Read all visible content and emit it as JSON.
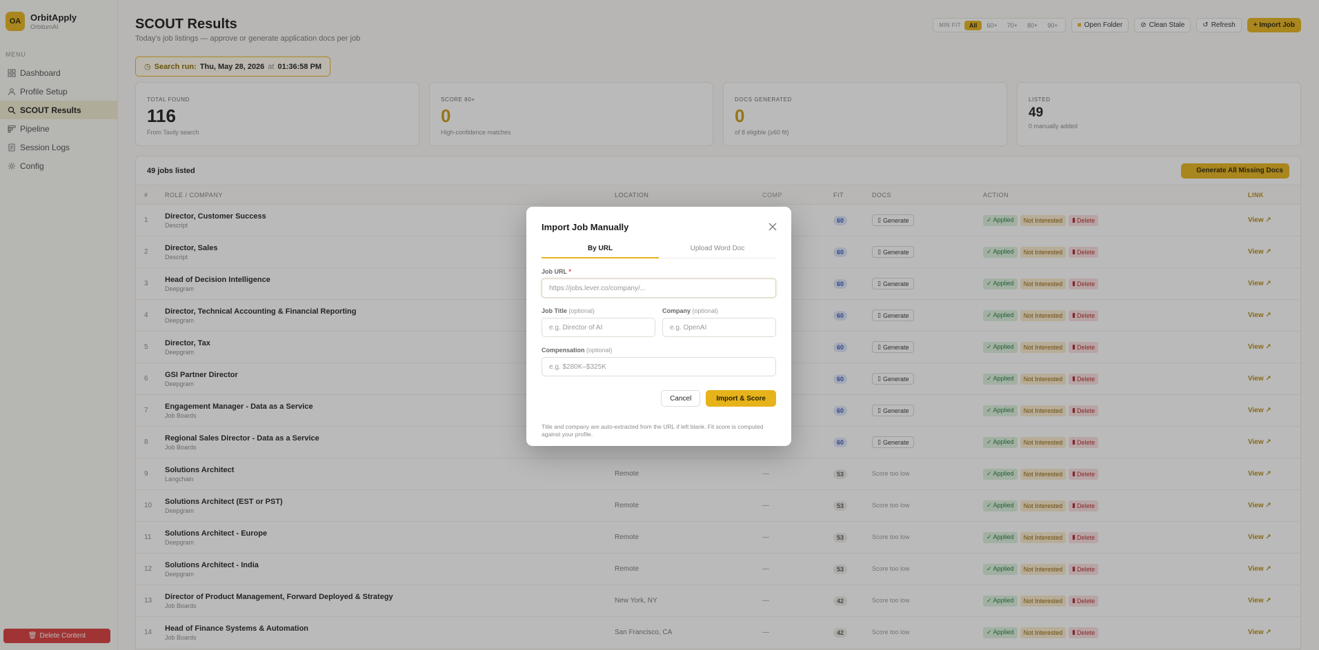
{
  "brand": {
    "initials": "OA",
    "name": "OrbitApply",
    "sub": "OrbitumAI"
  },
  "sidebar": {
    "menu_label": "MENU",
    "items": [
      {
        "label": "Dashboard",
        "icon": "grid-icon"
      },
      {
        "label": "Profile Setup",
        "icon": "user-icon"
      },
      {
        "label": "SCOUT Results",
        "icon": "search-icon",
        "active": true
      },
      {
        "label": "Pipeline",
        "icon": "pipeline-icon"
      },
      {
        "label": "Session Logs",
        "icon": "document-icon"
      },
      {
        "label": "Config",
        "icon": "gear-icon"
      }
    ],
    "delete_label": "Delete Content"
  },
  "page": {
    "title": "SCOUT Results",
    "subtitle": "Today's job listings — approve or generate application docs per job"
  },
  "toolbar": {
    "min_fit_label": "MIN FIT",
    "fit_options": [
      "All",
      "60+",
      "70+",
      "80+",
      "90+"
    ],
    "open_folder": "Open Folder",
    "clean_stale": "Clean Stale",
    "refresh": "Refresh",
    "import_job": "+ Import Job"
  },
  "search_run": {
    "label": "Search run:",
    "date": "Thu, May 28, 2026",
    "at": "at",
    "time": "01:36:58 PM"
  },
  "stats": [
    {
      "label": "TOTAL FOUND",
      "value": "116",
      "note": "From Tavily search"
    },
    {
      "label": "SCORE 80+",
      "value": "0",
      "note": "High-confidence matches"
    },
    {
      "label": "DOCS GENERATED",
      "value": "0",
      "note": "of 8 eligible (≥60 fit)"
    },
    {
      "label": "LISTED",
      "value": "49",
      "note": "0 manually added"
    }
  ],
  "table": {
    "count_label": "49 jobs listed",
    "generate_all": "Generate All Missing Docs",
    "headers": {
      "num": "#",
      "role": "ROLE / COMPANY",
      "location": "LOCATION",
      "comp": "COMP",
      "fit": "FIT",
      "docs": "DOCS",
      "action": "ACTION",
      "link": "LINK"
    },
    "generate_label": "Generate",
    "score_low_label": "Score too low",
    "applied_label": "✓ Applied",
    "not_interested_label": "Not Interested",
    "delete_label": "Delete",
    "view_label": "View ↗",
    "rows": [
      {
        "num": "1",
        "title": "Director, Customer Success",
        "company": "Descript",
        "location": "",
        "comp": "",
        "fit": "60",
        "docs": "generate"
      },
      {
        "num": "2",
        "title": "Director, Sales",
        "company": "Descript",
        "location": "",
        "comp": "",
        "fit": "60",
        "docs": "generate"
      },
      {
        "num": "3",
        "title": "Head of Decision Intelligence",
        "company": "Deepgram",
        "location": "",
        "comp": "",
        "fit": "60",
        "docs": "generate"
      },
      {
        "num": "4",
        "title": "Director, Technical Accounting & Financial Reporting",
        "company": "Deepgram",
        "location": "",
        "comp": "",
        "fit": "60",
        "docs": "generate"
      },
      {
        "num": "5",
        "title": "Director, Tax",
        "company": "Deepgram",
        "location": "",
        "comp": "",
        "fit": "60",
        "docs": "generate"
      },
      {
        "num": "6",
        "title": "GSI Partner Director",
        "company": "Deepgram",
        "location": "",
        "comp": "",
        "fit": "60",
        "docs": "generate"
      },
      {
        "num": "7",
        "title": "Engagement Manager - Data as a Service",
        "company": "Job Boards",
        "location": "",
        "comp": "",
        "fit": "60",
        "docs": "generate"
      },
      {
        "num": "8",
        "title": "Regional Sales Director - Data as a Service",
        "company": "Job Boards",
        "location": "",
        "comp": "",
        "fit": "60",
        "docs": "generate"
      },
      {
        "num": "9",
        "title": "Solutions Architect",
        "company": "Langchain",
        "location": "Remote",
        "comp": "—",
        "fit": "53",
        "docs": "low"
      },
      {
        "num": "10",
        "title": "Solutions Architect (EST or PST)",
        "company": "Deepgram",
        "location": "Remote",
        "comp": "—",
        "fit": "53",
        "docs": "low"
      },
      {
        "num": "11",
        "title": "Solutions Architect - Europe",
        "company": "Deepgram",
        "location": "Remote",
        "comp": "—",
        "fit": "53",
        "docs": "low"
      },
      {
        "num": "12",
        "title": "Solutions Architect - India",
        "company": "Deepgram",
        "location": "Remote",
        "comp": "—",
        "fit": "53",
        "docs": "low"
      },
      {
        "num": "13",
        "title": "Director of Product Management, Forward Deployed & Strategy",
        "company": "Job Boards",
        "location": "New York, NY",
        "comp": "—",
        "fit": "42",
        "docs": "low"
      },
      {
        "num": "14",
        "title": "Head of Finance Systems & Automation",
        "company": "Job Boards",
        "location": "San Francisco, CA",
        "comp": "—",
        "fit": "42",
        "docs": "low"
      }
    ]
  },
  "modal": {
    "title": "Import Job Manually",
    "tab_url": "By URL",
    "tab_doc": "Upload Word Doc",
    "url_label": "Job URL",
    "url_required": "*",
    "url_placeholder": "https://jobs.lever.co/company/...",
    "title_label": "Job Title",
    "title_optional": "(optional)",
    "title_placeholder": "e.g. Director of AI",
    "company_label": "Company",
    "company_optional": "(optional)",
    "company_placeholder": "e.g. OpenAI",
    "comp_label": "Compensation",
    "comp_optional": "(optional)",
    "comp_placeholder": "e.g. $280K–$325K",
    "cancel": "Cancel",
    "import": "Import & Score",
    "note": "Title and company are auto-extracted from the URL if left blank. Fit score is computed against your profile."
  }
}
